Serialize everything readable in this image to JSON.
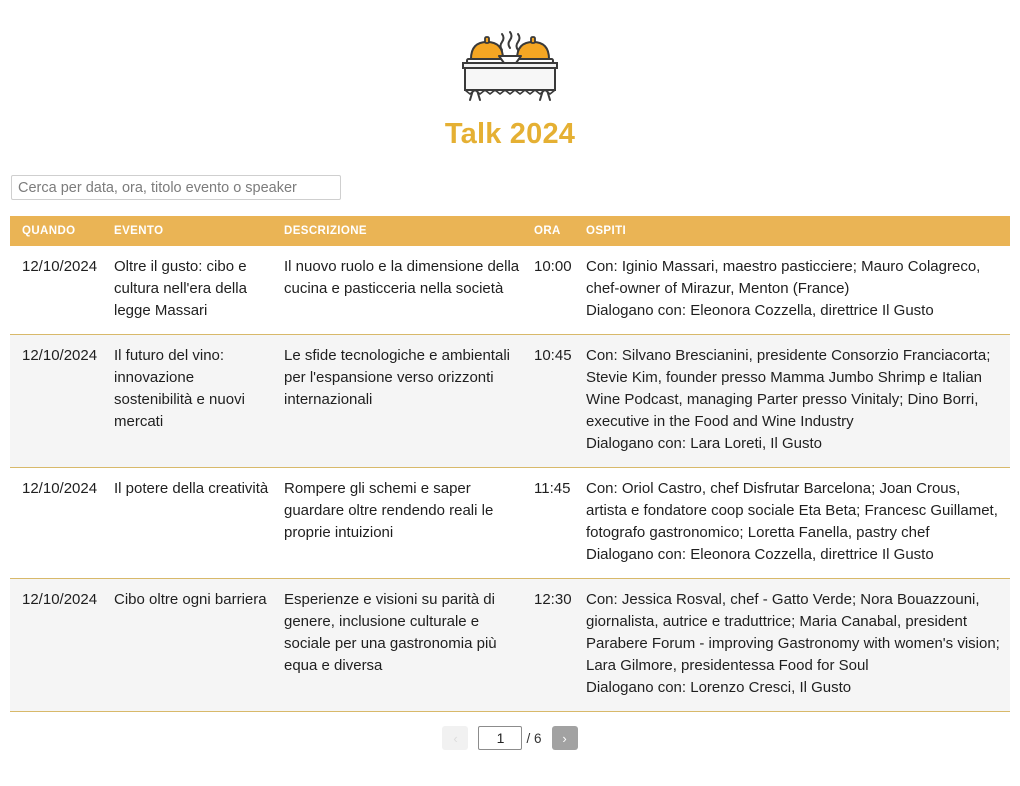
{
  "header": {
    "logo_icon": "buffet-table-cloches-icon",
    "title": "Talk 2024",
    "title_color": "#e5b033"
  },
  "search": {
    "placeholder": "Cerca per data, ora, titolo evento o speaker",
    "value": ""
  },
  "table": {
    "accent_color": "#eab455",
    "row_border_color": "#d8b96a",
    "columns": [
      {
        "key": "quando",
        "label": "QUANDO"
      },
      {
        "key": "evento",
        "label": "EVENTO"
      },
      {
        "key": "descrizione",
        "label": "DESCRIZIONE"
      },
      {
        "key": "ora",
        "label": "ORA"
      },
      {
        "key": "ospiti",
        "label": "OSPITI"
      }
    ],
    "rows": [
      {
        "quando": "12/10/2024",
        "evento": "Oltre il gusto: cibo e cultura nell'era della legge Massari",
        "descrizione": "Il nuovo ruolo e la dimensione della cucina e pasticceria nella società",
        "ora": "10:00",
        "ospiti_con": "Con: Iginio Massari, maestro pasticciere; Mauro Colagreco, chef-owner of Mirazur, Menton (France)",
        "ospiti_dialogano": "Dialogano con: Eleonora Cozzella, direttrice Il Gusto"
      },
      {
        "quando": "12/10/2024",
        "evento": "Il futuro del vino: innovazione sostenibilità e nuovi mercati",
        "descrizione": "Le sfide tecnologiche e ambientali per l'espansione verso orizzonti internazionali",
        "ora": "10:45",
        "ospiti_con": "Con: Silvano Brescianini, presidente Consorzio Franciacorta; Stevie Kim, founder presso Mamma Jumbo Shrimp e Italian Wine Podcast, managing Parter presso Vinitaly; Dino Borri, executive in the Food and Wine Industry",
        "ospiti_dialogano": "Dialogano con: Lara Loreti, Il Gusto"
      },
      {
        "quando": "12/10/2024",
        "evento": "Il potere della creatività",
        "descrizione": "Rompere gli schemi e saper guardare oltre rendendo reali le proprie intuizioni",
        "ora": "11:45",
        "ospiti_con": "Con: Oriol Castro, chef Disfrutar Barcelona; Joan Crous, artista e fondatore coop sociale Eta Beta; Francesc Guillamet, fotografo gastronomico; Loretta Fanella, pastry chef",
        "ospiti_dialogano": "Dialogano con: Eleonora Cozzella, direttrice Il Gusto"
      },
      {
        "quando": "12/10/2024",
        "evento": "Cibo oltre ogni barriera",
        "descrizione": "Esperienze e visioni su parità di genere, inclusione culturale e sociale per una gastronomia più equa e diversa",
        "ora": "12:30",
        "ospiti_con": "Con: Jessica Rosval, chef - Gatto Verde; Nora Bouazzouni, giornalista, autrice e traduttrice; Maria Canabal, president Parabere Forum - improving Gastronomy with women's vision; Lara Gilmore, presidentessa Food for Soul",
        "ospiti_dialogano": "Dialogano con: Lorenzo Cresci, Il Gusto"
      }
    ]
  },
  "pagination": {
    "prev_label": "‹",
    "next_label": "›",
    "current_page": "1",
    "total_label": "/ 6"
  }
}
